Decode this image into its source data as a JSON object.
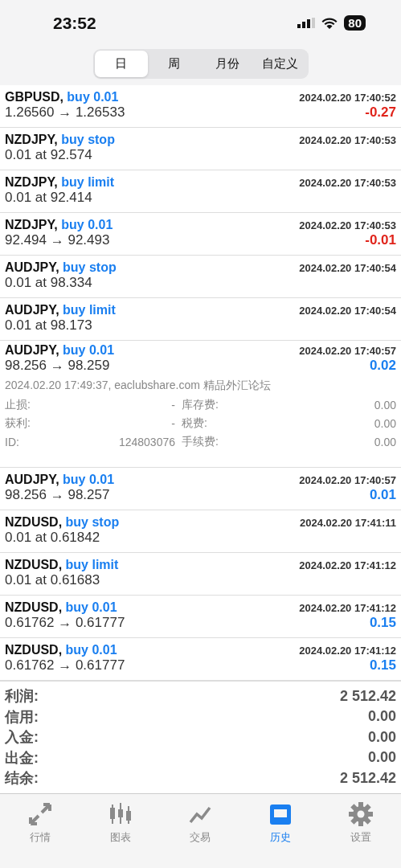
{
  "status_bar": {
    "time": "23:52",
    "battery": "80"
  },
  "period_tabs": [
    {
      "label": "日",
      "selected": true
    },
    {
      "label": "周",
      "selected": false
    },
    {
      "label": "月份",
      "selected": false
    },
    {
      "label": "自定义",
      "selected": false
    }
  ],
  "deals": [
    {
      "symbol": "GBPUSD,",
      "type": "buy 0.01",
      "time": "2024.02.20 17:40:52",
      "prices": "1.26560 → 1.26533",
      "profit": "-0.27",
      "loss": true
    },
    {
      "symbol": "NZDJPY,",
      "type": "buy stop",
      "time": "2024.02.20 17:40:53",
      "prices": "0.01 at 92.574"
    },
    {
      "symbol": "NZDJPY,",
      "type": "buy limit",
      "time": "2024.02.20 17:40:53",
      "prices": "0.01 at 92.414"
    },
    {
      "symbol": "NZDJPY,",
      "type": "buy 0.01",
      "time": "2024.02.20 17:40:53",
      "prices": "92.494 → 92.493",
      "profit": "-0.01",
      "loss": true
    },
    {
      "symbol": "AUDJPY,",
      "type": "buy stop",
      "time": "2024.02.20 17:40:54",
      "prices": "0.01 at 98.334"
    },
    {
      "symbol": "AUDJPY,",
      "type": "buy limit",
      "time": "2024.02.20 17:40:54",
      "prices": "0.01 at 98.173"
    },
    {
      "symbol": "AUDJPY,",
      "type": "buy 0.01",
      "time": "2024.02.20 17:40:57",
      "prices": "98.256 → 98.259",
      "profit": "0.02",
      "loss": false,
      "expanded": true,
      "details": {
        "comment": "2024.02.20 17:49:37, eaclubshare.com 精品外汇论坛",
        "fields": [
          {
            "label": "止损:",
            "value": "-",
            "label2": "库存费:",
            "value2": "0.00"
          },
          {
            "label": "获利:",
            "value": "-",
            "label2": "税费:",
            "value2": "0.00"
          },
          {
            "label": "ID:",
            "value": "124803076",
            "label2": "手续费:",
            "value2": "0.00"
          }
        ]
      }
    },
    {
      "symbol": "AUDJPY,",
      "type": "buy 0.01",
      "time": "2024.02.20 17:40:57",
      "prices": "98.256 → 98.257",
      "profit": "0.01",
      "loss": false
    },
    {
      "symbol": "NZDUSD,",
      "type": "buy stop",
      "time": "2024.02.20 17:41:11",
      "prices": "0.01 at 0.61842"
    },
    {
      "symbol": "NZDUSD,",
      "type": "buy limit",
      "time": "2024.02.20 17:41:12",
      "prices": "0.01 at 0.61683"
    },
    {
      "symbol": "NZDUSD,",
      "type": "buy 0.01",
      "time": "2024.02.20 17:41:12",
      "prices": "0.61762 → 0.61777",
      "profit": "0.15",
      "loss": false
    },
    {
      "symbol": "NZDUSD,",
      "type": "buy 0.01",
      "time": "2024.02.20 17:41:12",
      "prices": "0.61762 → 0.61777",
      "profit": "0.15",
      "loss": false
    }
  ],
  "summary": [
    {
      "label": "利润:",
      "value": "2 512.42"
    },
    {
      "label": "信用:",
      "value": "0.00"
    },
    {
      "label": "入金:",
      "value": "0.00"
    },
    {
      "label": "出金:",
      "value": "0.00"
    },
    {
      "label": "结余:",
      "value": "2 512.42"
    }
  ],
  "tab_bar": [
    {
      "label": "行情",
      "kind": "quotes",
      "selected": false
    },
    {
      "label": "图表",
      "kind": "chart",
      "selected": false
    },
    {
      "label": "交易",
      "kind": "trade",
      "selected": false
    },
    {
      "label": "历史",
      "kind": "history",
      "selected": true
    },
    {
      "label": "设置",
      "kind": "settings",
      "selected": false
    }
  ]
}
